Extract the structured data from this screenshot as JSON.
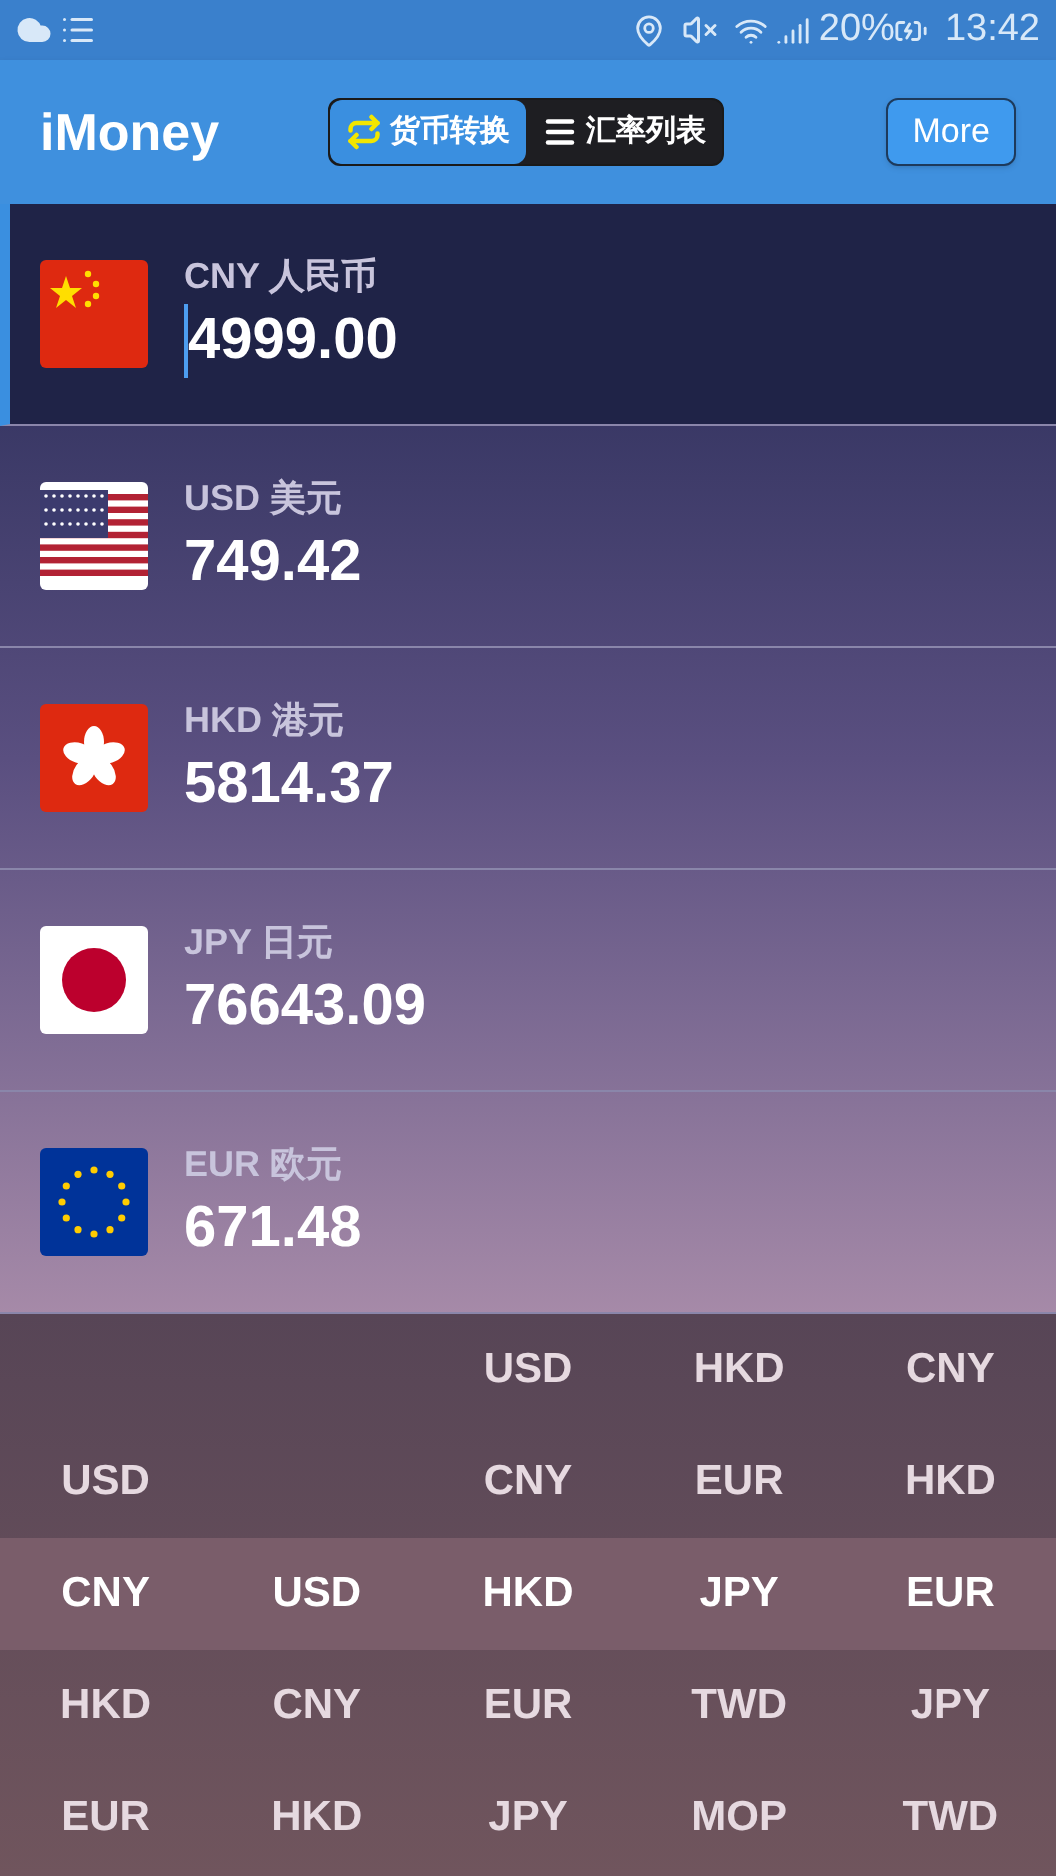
{
  "status_bar": {
    "battery": "20%",
    "time": "13:42"
  },
  "header": {
    "title": "iMoney",
    "tabs": [
      {
        "label": "货币转换",
        "selected": true
      },
      {
        "label": "汇率列表",
        "selected": false
      }
    ],
    "more_button": "More"
  },
  "currencies": [
    {
      "kind": "china",
      "label": "CNY 人民币",
      "amount": "4999.00",
      "selected": true
    },
    {
      "kind": "usa",
      "label": "USD 美元",
      "amount": "749.42",
      "selected": false
    },
    {
      "kind": "hongkong",
      "label": "HKD 港元",
      "amount": "5814.37",
      "selected": false
    },
    {
      "kind": "japan",
      "label": "JPY 日元",
      "amount": "76643.09",
      "selected": false
    },
    {
      "kind": "eu",
      "label": "EUR 欧元",
      "amount": "671.48",
      "selected": false
    }
  ],
  "picker": {
    "columns": [
      {
        "items": [
          {
            "label": "USD",
            "selected": false
          },
          {
            "label": "CNY",
            "selected": true
          },
          {
            "label": "HKD",
            "selected": false
          },
          {
            "label": "EUR",
            "selected": false
          }
        ]
      },
      {
        "items": [
          {
            "label": "USD",
            "selected": true
          },
          {
            "label": "CNY",
            "selected": false
          },
          {
            "label": "HKD",
            "selected": false
          }
        ]
      },
      {
        "items": [
          {
            "label": "USD",
            "selected": false
          },
          {
            "label": "CNY",
            "selected": false
          },
          {
            "label": "HKD",
            "selected": true
          },
          {
            "label": "EUR",
            "selected": false
          },
          {
            "label": "JPY",
            "selected": false
          }
        ]
      },
      {
        "items": [
          {
            "label": "HKD",
            "selected": false
          },
          {
            "label": "EUR",
            "selected": false
          },
          {
            "label": "JPY",
            "selected": true
          },
          {
            "label": "TWD",
            "selected": false
          },
          {
            "label": "MOP",
            "selected": false
          }
        ]
      },
      {
        "items": [
          {
            "label": "CNY",
            "selected": false
          },
          {
            "label": "HKD",
            "selected": false
          },
          {
            "label": "EUR",
            "selected": true
          },
          {
            "label": "JPY",
            "selected": false
          },
          {
            "label": "TWD",
            "selected": false
          }
        ]
      }
    ]
  }
}
